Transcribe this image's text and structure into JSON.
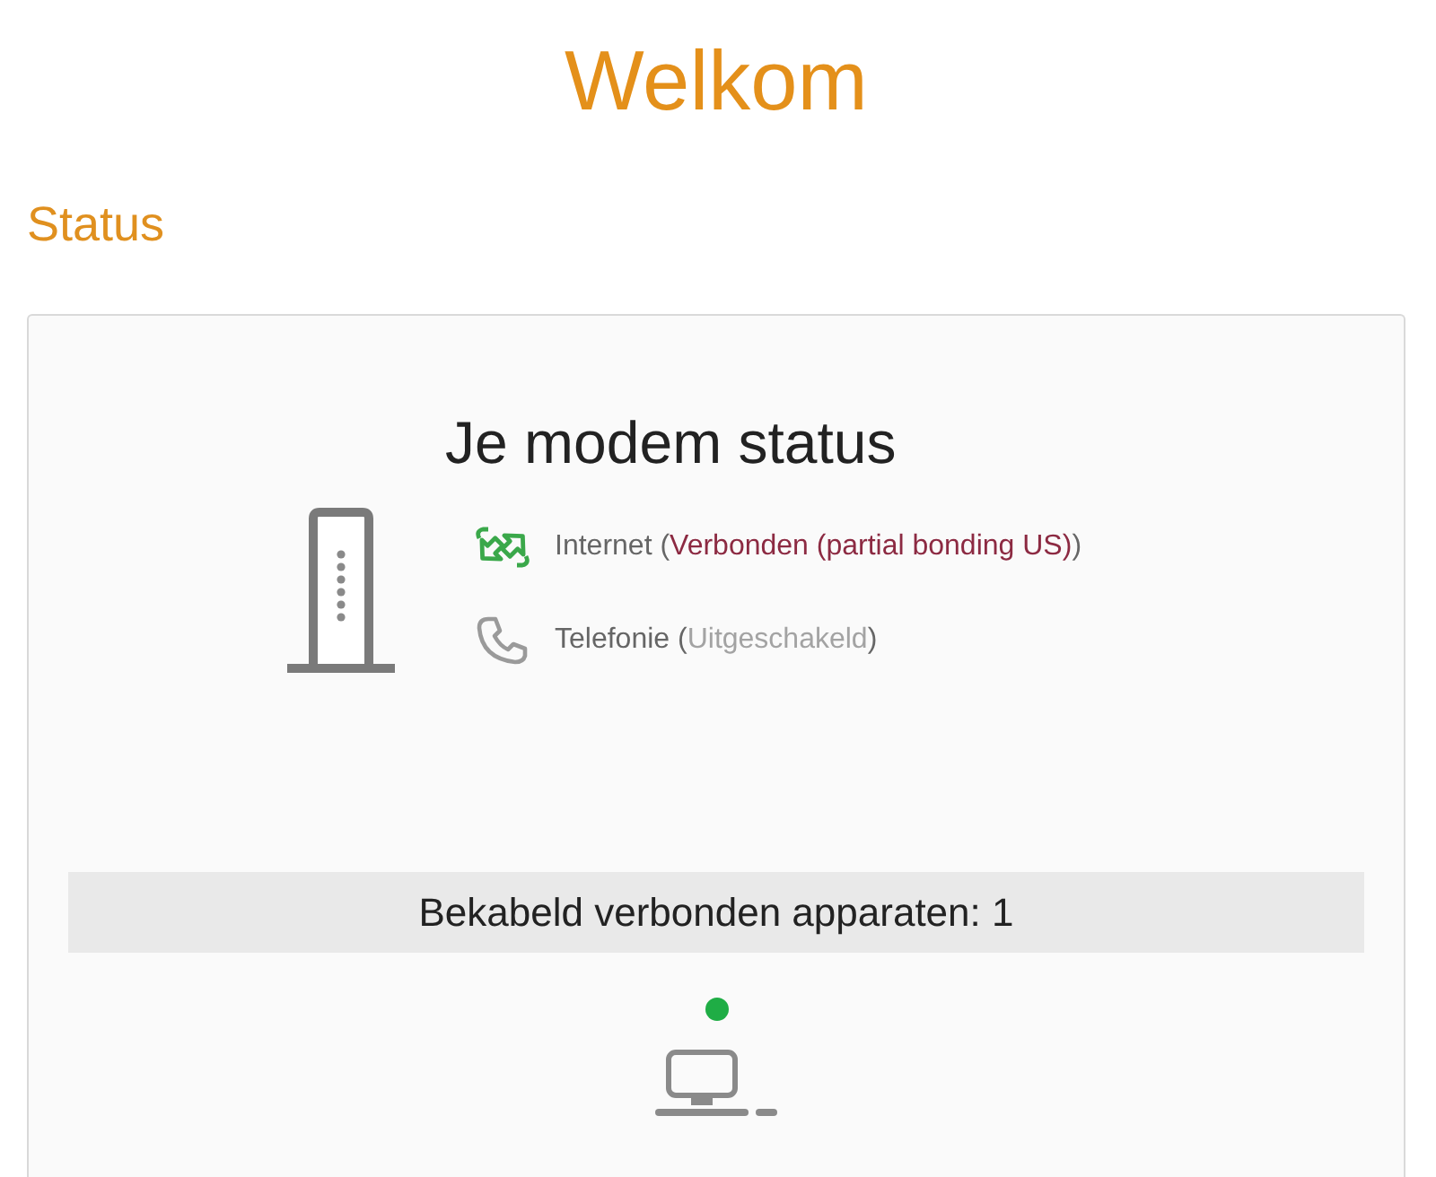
{
  "page_title": "Welkom",
  "section_title": "Status",
  "modem": {
    "title": "Je modem status",
    "services": [
      {
        "kind": "internet",
        "active": true,
        "label": "Internet (",
        "status": "Verbonden (partial bonding US)",
        "label_end": ")"
      },
      {
        "kind": "phone",
        "active": false,
        "label": "Telefonie (",
        "status": "Uitgeschakeld",
        "label_end": ")"
      }
    ]
  },
  "wired_devices": {
    "title": "Bekabeld verbonden apparaten: 1",
    "devices": [
      {
        "kind": "computer",
        "online": true
      }
    ]
  }
}
